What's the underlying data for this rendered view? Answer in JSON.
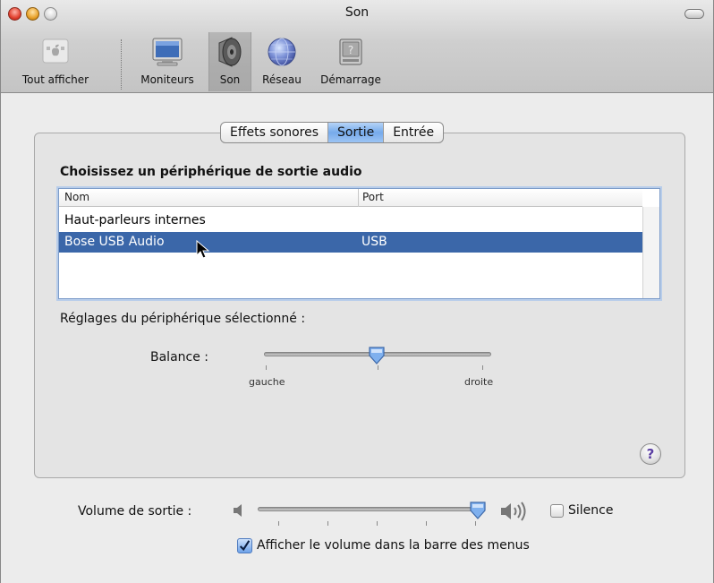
{
  "window": {
    "title": "Son"
  },
  "toolbar": {
    "items": [
      {
        "label": "Tout afficher",
        "icon": "apple-grid-icon"
      },
      {
        "label": "Moniteurs",
        "icon": "monitor-icon"
      },
      {
        "label": "Son",
        "icon": "speaker-icon",
        "selected": true
      },
      {
        "label": "Réseau",
        "icon": "globe-icon"
      },
      {
        "label": "Démarrage",
        "icon": "hard-disk-icon"
      }
    ]
  },
  "tabs": [
    {
      "label": "Effets sonores",
      "active": false
    },
    {
      "label": "Sortie",
      "active": true
    },
    {
      "label": "Entrée",
      "active": false
    }
  ],
  "output": {
    "section_title": "Choisissez un périphérique de sortie audio",
    "columns": [
      "Nom",
      "Port"
    ],
    "rows": [
      {
        "name": "Haut-parleurs internes",
        "port": "",
        "selected": false
      },
      {
        "name": "Bose USB Audio",
        "port": "USB",
        "selected": true
      }
    ],
    "settings_label": "Réglages du périphérique sélectionné :",
    "balance": {
      "label": "Balance :",
      "left_label": "gauche",
      "right_label": "droite",
      "value": 0.47
    }
  },
  "volume": {
    "label": "Volume de sortie :",
    "value": 0.95,
    "silence_label": "Silence",
    "silence_checked": false,
    "menubar_label": "Afficher le volume dans la barre des menus",
    "menubar_checked": true
  },
  "colors": {
    "selection": "#3b67a9",
    "accent": "#76aaeb"
  }
}
